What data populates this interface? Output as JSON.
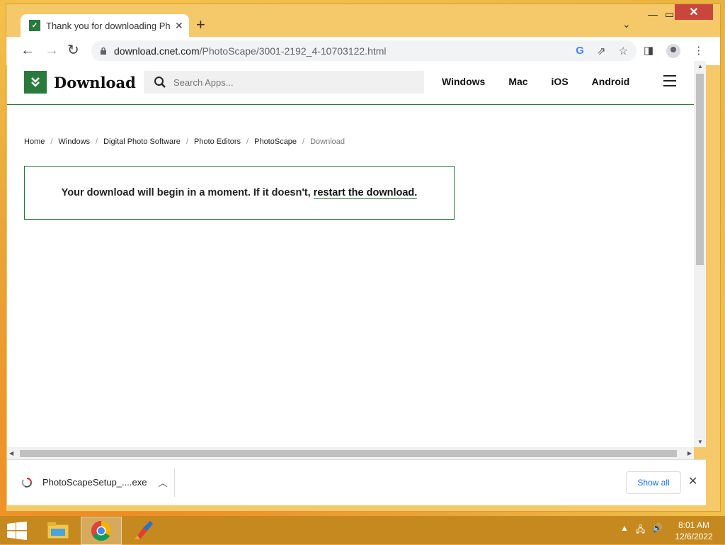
{
  "browser": {
    "tab_title": "Thank you for downloading PhotoScape",
    "new_tab_label": "+",
    "url_host": "download.cnet.com",
    "url_path": "/PhotoScape/3001-2192_4-10703122.html"
  },
  "site": {
    "logo_text": "Download",
    "search_placeholder": "Search Apps...",
    "nav": [
      "Windows",
      "Mac",
      "iOS",
      "Android"
    ]
  },
  "breadcrumb": [
    "Home",
    "Windows",
    "Digital Photo Software",
    "Photo Editors",
    "PhotoScape",
    "Download"
  ],
  "notice": {
    "text": "Your download will begin in a moment. If it doesn't,",
    "link": "restart the download."
  },
  "downloads": {
    "file_name": "PhotoScapeSetup_....exe",
    "show_all_label": "Show all"
  },
  "taskbar": {
    "time": "8:01 AM",
    "date": "12/6/2022"
  },
  "colors": {
    "brand_green": "#2b7a3d",
    "link_blue": "#1a73e8",
    "window_frame": "#f5c96a",
    "close_red": "#c9463d"
  }
}
